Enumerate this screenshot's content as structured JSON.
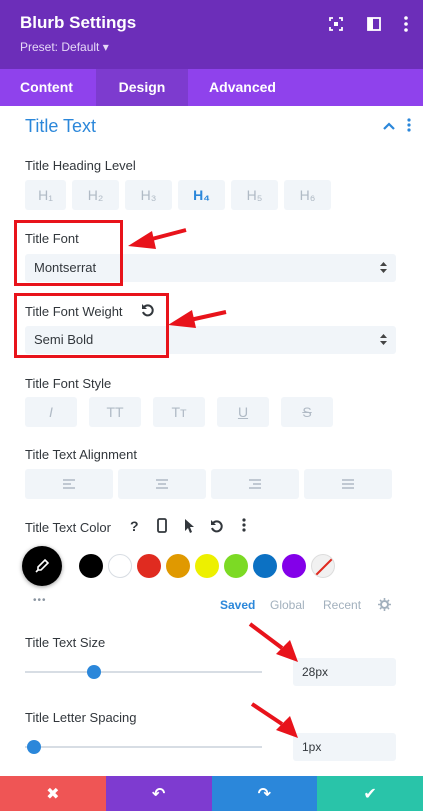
{
  "header": {
    "title": "Blurb Settings",
    "preset": "Preset: Default ▾",
    "icons": [
      "expand-icon",
      "sidebar-toggle-icon",
      "more-options-icon"
    ]
  },
  "tabs": [
    {
      "label": "Content",
      "active": false
    },
    {
      "label": "Design",
      "active": true
    },
    {
      "label": "Advanced",
      "active": false
    }
  ],
  "section": {
    "title": "Title Text",
    "collapse_icon": "chevron-up-icon",
    "menu_icon": "vertical-dots-icon"
  },
  "heading_level": {
    "label": "Title Heading Level",
    "options": [
      "H₁",
      "H₂",
      "H₃",
      "H₄",
      "H₅",
      "H₆"
    ],
    "selected": "H₄"
  },
  "title_font": {
    "label": "Title Font",
    "value": "Montserrat"
  },
  "title_font_weight": {
    "label": "Title Font Weight",
    "reset_icon": "reset-icon",
    "value": "Semi Bold"
  },
  "title_font_style": {
    "label": "Title Font Style",
    "options": [
      "I",
      "TT",
      "Tт",
      "U",
      "S"
    ]
  },
  "title_text_alignment": {
    "label": "Title Text Alignment",
    "options": [
      "align-left-icon",
      "align-center-icon",
      "align-right-icon",
      "align-justify-icon"
    ]
  },
  "title_text_color": {
    "label": "Title Text Color",
    "help_label": "?",
    "icons": [
      "help-icon",
      "mobile-icon",
      "hover-cursor-icon",
      "reset-icon",
      "more-icon"
    ],
    "selected_color": "#000000",
    "swatches": [
      "#000000",
      "#ffffff",
      "#e02b20",
      "#e09900",
      "#edf000",
      "#7cda24",
      "#0c71c3",
      "#8300e9"
    ],
    "more_label": "•••",
    "palette_tabs": [
      "Saved",
      "Global",
      "Recent"
    ],
    "active_palette_tab": "Saved"
  },
  "title_text_size": {
    "label": "Title Text Size",
    "value": "28px",
    "slider_fraction": 0.29
  },
  "title_letter_spacing": {
    "label": "Title Letter Spacing",
    "value": "1px",
    "slider_fraction": 0.04
  },
  "footer": {
    "buttons": [
      {
        "icon": "close-icon",
        "glyph": "✖",
        "color": "#ef5555"
      },
      {
        "icon": "undo-icon",
        "glyph": "↶",
        "color": "#7e3bd0"
      },
      {
        "icon": "redo-icon",
        "glyph": "↷",
        "color": "#2b87da"
      },
      {
        "icon": "save-check-icon",
        "glyph": "✔",
        "color": "#29c4a9"
      }
    ]
  },
  "colors": {
    "header": "#6c2eb9",
    "tabs": "#8f42ec",
    "accent": "#2b87da",
    "annotation": "#e8131b"
  }
}
